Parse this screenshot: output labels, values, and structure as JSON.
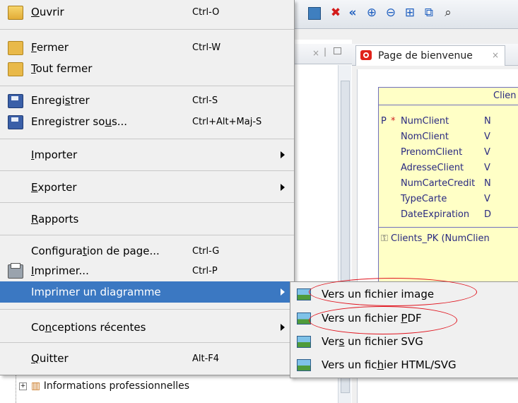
{
  "background": {
    "editor_tab": {
      "label": "Page de bienvenue",
      "close": "×"
    },
    "entity": {
      "title": "Clien",
      "attributes": [
        {
          "pk": "P",
          "star": "*",
          "name": "NumClient",
          "type": "N"
        },
        {
          "pk": "",
          "star": "",
          "name": "NomClient",
          "type": "V"
        },
        {
          "pk": "",
          "star": "",
          "name": "PrenomClient",
          "type": "V"
        },
        {
          "pk": "",
          "star": "",
          "name": "AdresseClient",
          "type": "V"
        },
        {
          "pk": "",
          "star": "",
          "name": "NumCarteCredit",
          "type": "N"
        },
        {
          "pk": "",
          "star": "",
          "name": "TypeCarte",
          "type": "V"
        },
        {
          "pk": "",
          "star": "",
          "name": "DateExpiration",
          "type": "D"
        }
      ],
      "key": "Clients_PK (NumClien"
    },
    "tree_item": "Informations professionnelles",
    "toolbar_icons": [
      "image-icon",
      "delete-icon",
      "back-icon",
      "zoom-in-icon",
      "zoom-out-icon",
      "fit-icon",
      "layout-icon",
      "find-icon"
    ]
  },
  "menu": {
    "items": [
      {
        "label": "Ouvrir",
        "shortcut": "Ctrl-O",
        "icon": "folder-open-icon"
      },
      {
        "label": "Fermer",
        "shortcut": "Ctrl-W",
        "icon": "folder-icon"
      },
      {
        "label": "Tout fermer",
        "shortcut": "",
        "icon": "folder-icon"
      },
      {
        "label": "Enregistrer",
        "shortcut": "Ctrl-S",
        "icon": "save-icon"
      },
      {
        "label": "Enregistrer sous...",
        "shortcut": "Ctrl+Alt+Maj-S",
        "icon": "save-as-icon"
      },
      {
        "label": "Importer",
        "shortcut": "",
        "submenu": true
      },
      {
        "label": "Exporter",
        "shortcut": "",
        "submenu": true
      },
      {
        "label": "Rapports",
        "shortcut": ""
      },
      {
        "label": "Configuration de page...",
        "shortcut": "Ctrl-G"
      },
      {
        "label": "Imprimer...",
        "shortcut": "Ctrl-P",
        "icon": "printer-icon"
      },
      {
        "label": "Imprimer un diagramme",
        "shortcut": "",
        "submenu": true,
        "highlighted": true
      },
      {
        "label": "Conceptions récentes",
        "shortcut": "",
        "submenu": true
      },
      {
        "label": "Quitter",
        "shortcut": "Alt-F4"
      }
    ]
  },
  "submenu": {
    "items": [
      {
        "label": "Vers un fichier image",
        "circled": true
      },
      {
        "label": "Vers un fichier PDF",
        "circled": true
      },
      {
        "label": "Vers un fichier SVG"
      },
      {
        "label": "Vers un fichier HTML/SVG"
      }
    ]
  },
  "colors": {
    "highlight": "#3b78c2",
    "annotation": "#e0141e",
    "entity_fill": "#ffffc6"
  }
}
